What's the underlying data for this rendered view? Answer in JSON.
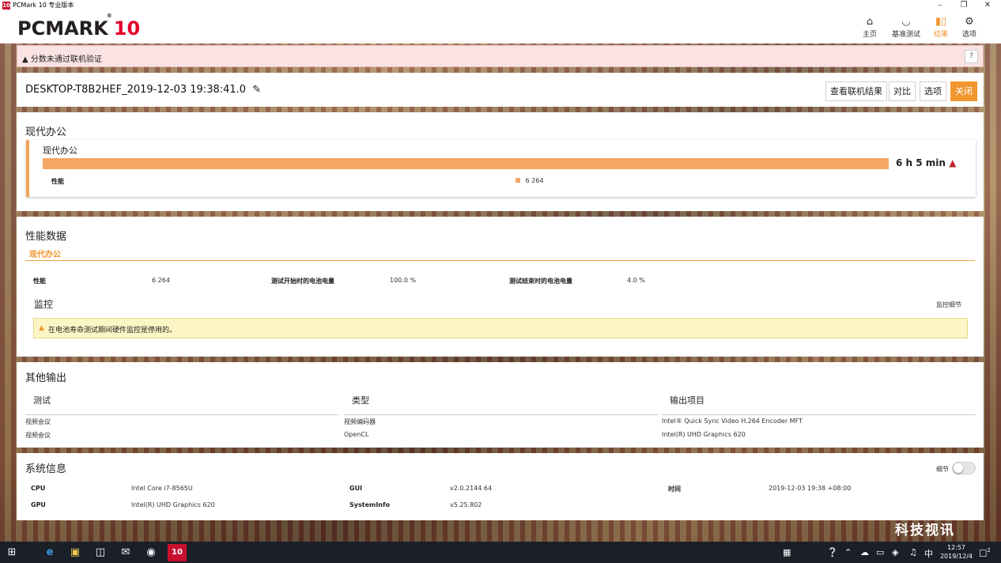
{
  "window": {
    "app_icon_text": "10",
    "title": "PCMark 10 专业版本",
    "controls": [
      "–",
      "❐",
      "✕"
    ]
  },
  "header": {
    "logo_main": "PCMARK",
    "logo_reg": "®",
    "logo_ten": "10",
    "nav": [
      {
        "label": "主页",
        "icon": "home-icon"
      },
      {
        "label": "基准测试",
        "icon": "gauge-icon"
      },
      {
        "label": "结果",
        "icon": "bar-chart-icon",
        "active": true
      },
      {
        "label": "选项",
        "icon": "gear-icon"
      }
    ]
  },
  "alert": {
    "icon": "warning-icon",
    "text": "分数未通过联机验证",
    "help": "?"
  },
  "result": {
    "name": "DESKTOP-T8B2HEF_2019-12-03 19:38:41.0",
    "buttons": {
      "view_online": "查看联机结果",
      "compare": "对比",
      "options": "选项",
      "close": "关闭"
    }
  },
  "summary": {
    "section_title": "现代办公",
    "card_title": "现代办公",
    "score_text": "6 h 5 min",
    "bar_fill": 1.0,
    "row_label": "性能",
    "row_value": "6 264"
  },
  "perf_data": {
    "section_title": "性能数据",
    "tab": "现代办公",
    "rows": [
      {
        "label": "性能",
        "value": "6 264"
      },
      {
        "label": "测试开始时的电池电量",
        "value": "100.0 %"
      },
      {
        "label": "测试结束时的电池电量",
        "value": "4.0 %"
      }
    ],
    "monitor_title": "监控",
    "monitor_detail": "监控细节",
    "monitor_warning": "在电池寿命测试期间硬件监控是停用的。"
  },
  "other_output": {
    "section_title": "其他输出",
    "columns": [
      "测试",
      "类型",
      "输出项目"
    ],
    "rows": [
      [
        "视频会议",
        "视频编码器",
        "Intel® Quick Sync Video H.264 Encoder MFT"
      ],
      [
        "视频会议",
        "OpenCL",
        "Intel(R) UHD Graphics 620"
      ]
    ]
  },
  "system_info": {
    "section_title": "系统信息",
    "toggle_label": "细节",
    "items": [
      {
        "label": "CPU",
        "value": "Intel Core i7-8565U"
      },
      {
        "label": "GUI",
        "value": "v2.0.2144 64"
      },
      {
        "label": "时间",
        "value": "2019-12-03 19:38 +08:00"
      },
      {
        "label": "GPU",
        "value": "Intel(R) UHD Graphics 620"
      },
      {
        "label": "SystemInfo",
        "value": "v5.25.802"
      }
    ]
  },
  "watermark": "科技视讯",
  "taskbar": {
    "time": "12:57",
    "date": "2019/12/4",
    "ime": "中",
    "notification_count": "2",
    "pinned_app_label": "10"
  },
  "colors": {
    "accent": "#f0962e",
    "bar": "#f5a665",
    "alert_bg": "#fbe3e3",
    "warning_bg": "#fcf6c6",
    "logo_red": "#e4002b"
  }
}
